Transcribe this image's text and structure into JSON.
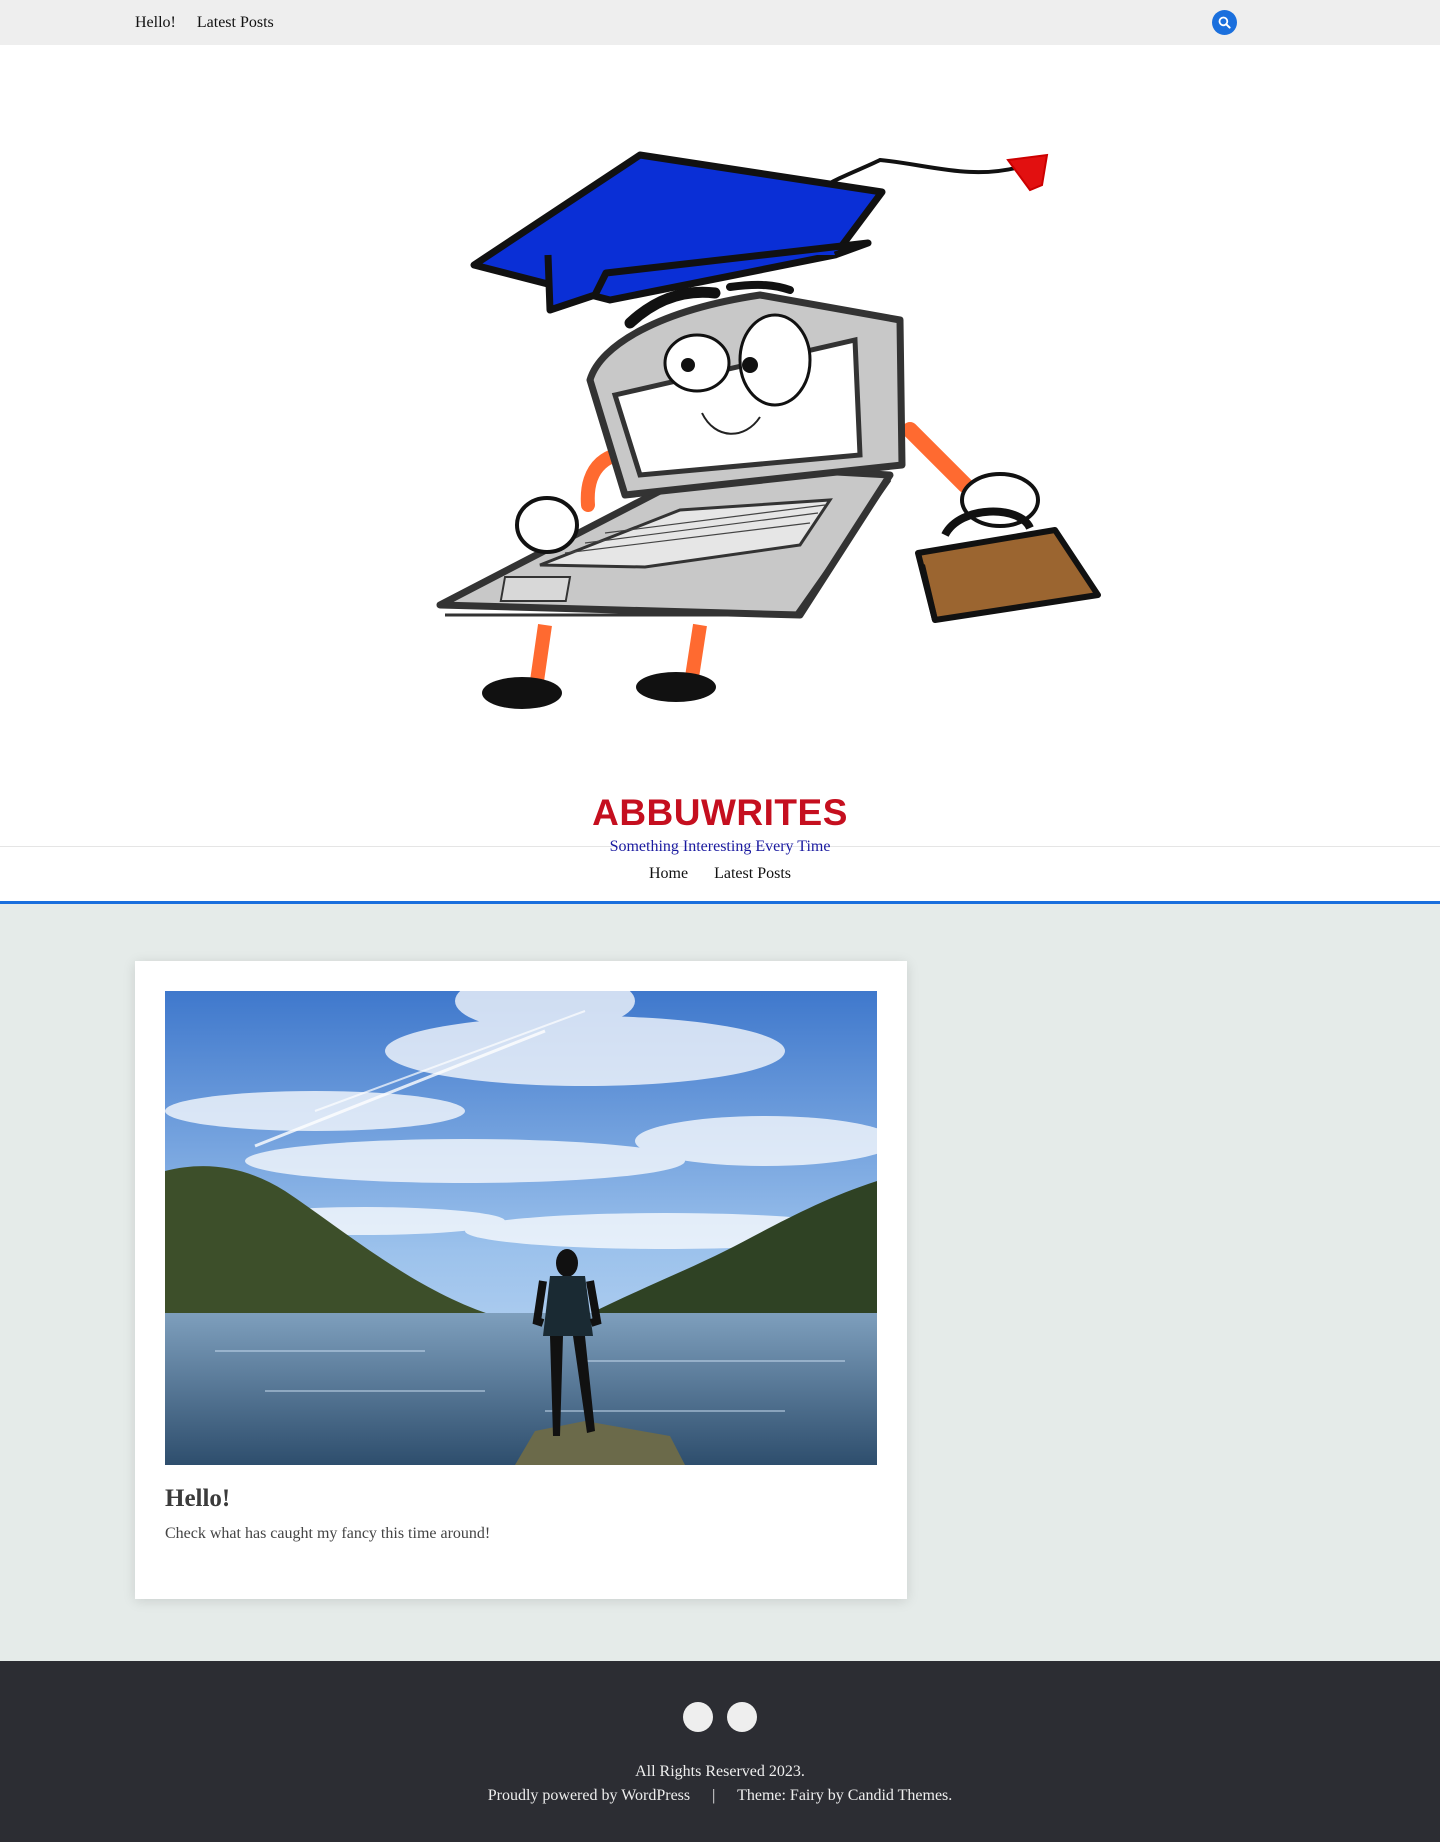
{
  "topbar": {
    "nav": [
      "Hello!",
      "Latest Posts"
    ],
    "search_icon": "search-icon"
  },
  "site": {
    "title": "ABBUWRITES",
    "tagline": "Something Interesting Every Time",
    "logo": "graduate-laptop-mascot"
  },
  "mainnav": [
    "Home",
    "Latest Posts"
  ],
  "post": {
    "title": "Hello!",
    "excerpt": "Check what has caught my fancy this time around!",
    "image": "lake-mountains-man-photo"
  },
  "footer": {
    "copyright": "All Rights Reserved 2023.",
    "powered_prefix": "Proudly powered by",
    "powered_link": "WordPress",
    "separator": "|",
    "theme_prefix": "Theme: Fairy by",
    "theme_link": "Candid Themes."
  },
  "colors": {
    "accent": "#1a6fdd",
    "title": "#c50f1f",
    "tagline": "#1a1aa0",
    "footer_bg": "#2c2d33",
    "content_bg": "#e5ebe9"
  }
}
